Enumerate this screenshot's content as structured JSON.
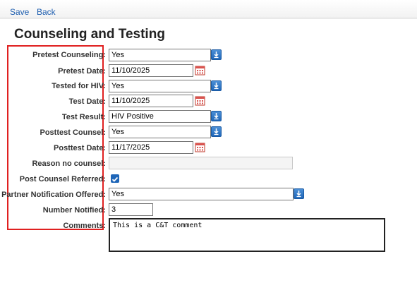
{
  "toolbar": {
    "save": "Save",
    "back": "Back"
  },
  "page_title": "Counseling and Testing",
  "colors": {
    "accent": "#1f66b8",
    "highlight_border": "#e02020"
  },
  "form": {
    "pretest_counseling": {
      "label": "Pretest Counseling:",
      "value": "Yes"
    },
    "pretest_date": {
      "label": "Pretest Date:",
      "value": "11/10/2025"
    },
    "tested_for_hiv": {
      "label": "Tested for HIV:",
      "value": "Yes"
    },
    "test_date": {
      "label": "Test Date:",
      "value": "11/10/2025"
    },
    "test_result": {
      "label": "Test Result:",
      "value": "HIV Positive"
    },
    "posttest_counsel": {
      "label": "Posttest Counsel:",
      "value": "Yes"
    },
    "posttest_date": {
      "label": "Posttest Date:",
      "value": "11/17/2025"
    },
    "reason_no_counsel": {
      "label": "Reason no counsel:",
      "value": ""
    },
    "post_counsel_referred": {
      "label": "Post Counsel Referred:",
      "checked": true
    },
    "partner_notification": {
      "label": "Partner Notification Offered:",
      "value": "Yes"
    },
    "number_notified": {
      "label": "Number Notified:",
      "value": "3"
    },
    "comments": {
      "label": "Comments:",
      "value": "This is a C&T comment"
    }
  }
}
